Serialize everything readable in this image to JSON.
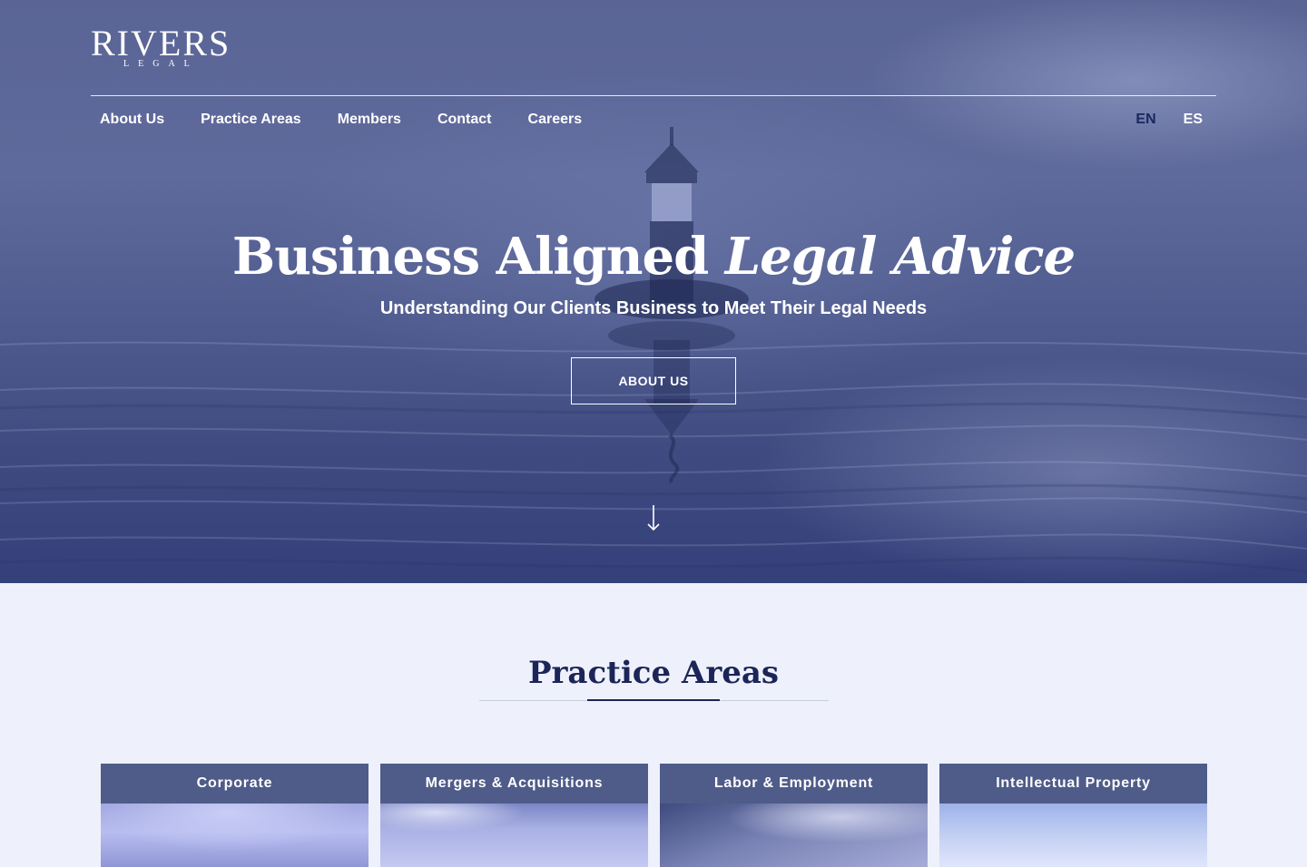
{
  "brand": {
    "name": "RIVERS",
    "sub": "LEGAL"
  },
  "nav": {
    "items": [
      {
        "label": "About Us"
      },
      {
        "label": "Practice Areas"
      },
      {
        "label": "Members"
      },
      {
        "label": "Contact"
      },
      {
        "label": "Careers"
      }
    ],
    "languages": [
      {
        "label": "EN",
        "active": true
      },
      {
        "label": "ES",
        "active": false
      }
    ]
  },
  "hero": {
    "title_regular": "Business Aligned ",
    "title_italic": "Legal Advice",
    "subtitle": "Understanding Our Clients Business to Meet Their Legal Needs",
    "button_label": "ABOUT US"
  },
  "practice": {
    "title": "Practice Areas",
    "cards": [
      {
        "label": "Corporate"
      },
      {
        "label": "Mergers & Acquisitions"
      },
      {
        "label": "Labor & Employment"
      },
      {
        "label": "Intellectual Property"
      }
    ]
  },
  "colors": {
    "accent_navy": "#1b2558",
    "card_header": "#4f5c89",
    "page_bg": "#eef1fb"
  }
}
